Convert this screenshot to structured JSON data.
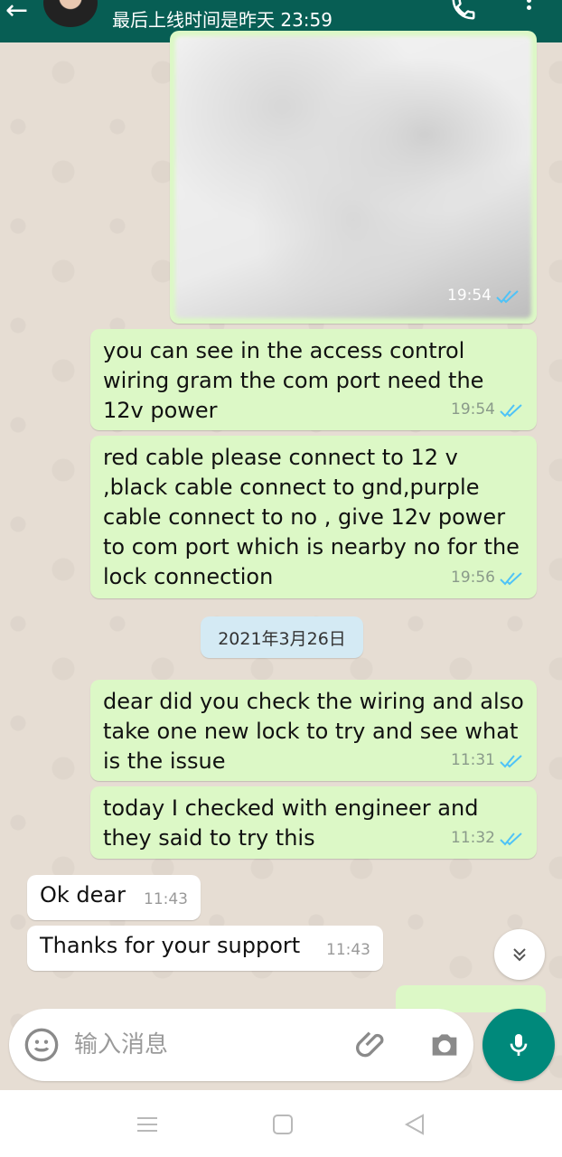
{
  "header": {
    "status": "最后上线时间是昨天 23:59"
  },
  "messages": [
    {
      "type": "image",
      "time": "19:54"
    },
    {
      "text": "you can see in the access control wiring gram the com port need the 12v power",
      "time": "19:54"
    },
    {
      "text": "red cable please connect to 12 v ,black cable connect to gnd,purple cable connect to no , give 12v power to com port which is nearby no for the lock connection",
      "time": "19:56"
    },
    {
      "text": "dear did you check the wiring and also take one new lock to try and see what is the issue",
      "time": "11:31"
    },
    {
      "text": "today I checked with engineer and they said to try this",
      "time": "11:32"
    },
    {
      "text": "Ok dear",
      "time": "11:43"
    },
    {
      "text": "Thanks for your support",
      "time": "11:43"
    }
  ],
  "date_chip": "2021年3月26日",
  "composer": {
    "placeholder": "输入消息"
  },
  "colors": {
    "header": "#075e54",
    "outgoing": "#dcf8c6",
    "incoming": "#ffffff",
    "tick_read": "#4fc3f7",
    "mic_button": "#00897b"
  },
  "icons": [
    "back-arrow-icon",
    "avatar",
    "call-icon",
    "menu-icon",
    "double-tick-icon",
    "scroll-down-icon",
    "emoji-icon",
    "attach-icon",
    "camera-icon",
    "mic-icon",
    "recent-apps-icon",
    "home-icon",
    "back-icon"
  ]
}
